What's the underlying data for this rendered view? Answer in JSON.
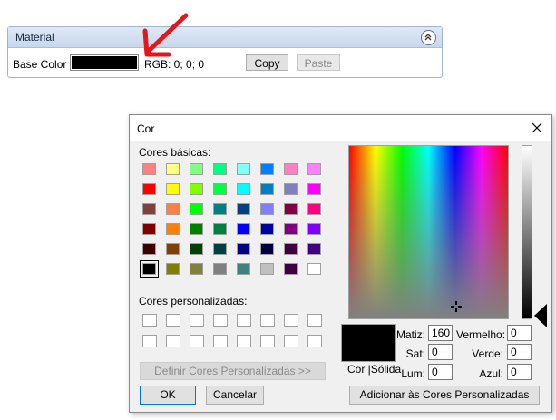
{
  "material": {
    "title": "Material",
    "base_color_label": "Base Color",
    "rgb_text": "RGB: 0; 0; 0",
    "copy_label": "Copy",
    "paste_label": "Paste"
  },
  "dialog": {
    "title": "Cor",
    "basic_colors_label": "Cores básicas:",
    "custom_colors_label": "Cores personalizadas:",
    "define_custom_label": "Definir Cores Personalizadas >>",
    "ok_label": "OK",
    "cancel_label": "Cancelar",
    "add_custom_label": "Adicionar às Cores Personalizadas",
    "preview_label": "Cor  |Sólida",
    "fields": {
      "hue_label": "Matiz:",
      "hue_value": "160",
      "sat_label": "Sat:",
      "sat_value": "0",
      "lum_label": "Lum:",
      "lum_value": "0",
      "red_label": "Vermelho:",
      "red_value": "0",
      "green_label": "Verde:",
      "green_value": "0",
      "blue_label": "Azul:",
      "blue_value": "0"
    },
    "basic_colors": [
      "#ff8080",
      "#ffff80",
      "#80ff80",
      "#00ff80",
      "#80ffff",
      "#0080ff",
      "#ff80c0",
      "#ff80ff",
      "#ff0000",
      "#ffff00",
      "#80ff00",
      "#00ff40",
      "#00ffff",
      "#0080c0",
      "#8080c0",
      "#ff00ff",
      "#804040",
      "#ff8040",
      "#00ff00",
      "#008080",
      "#004080",
      "#8080ff",
      "#800040",
      "#ff0080",
      "#800000",
      "#ff8000",
      "#008000",
      "#008040",
      "#0000ff",
      "#0000a0",
      "#800080",
      "#8000ff",
      "#400000",
      "#804000",
      "#004000",
      "#004040",
      "#000080",
      "#000040",
      "#400040",
      "#400080",
      "#000000",
      "#808000",
      "#808040",
      "#808080",
      "#408080",
      "#c0c0c0",
      "#400040",
      "#ffffff"
    ],
    "selected_index": 40
  }
}
